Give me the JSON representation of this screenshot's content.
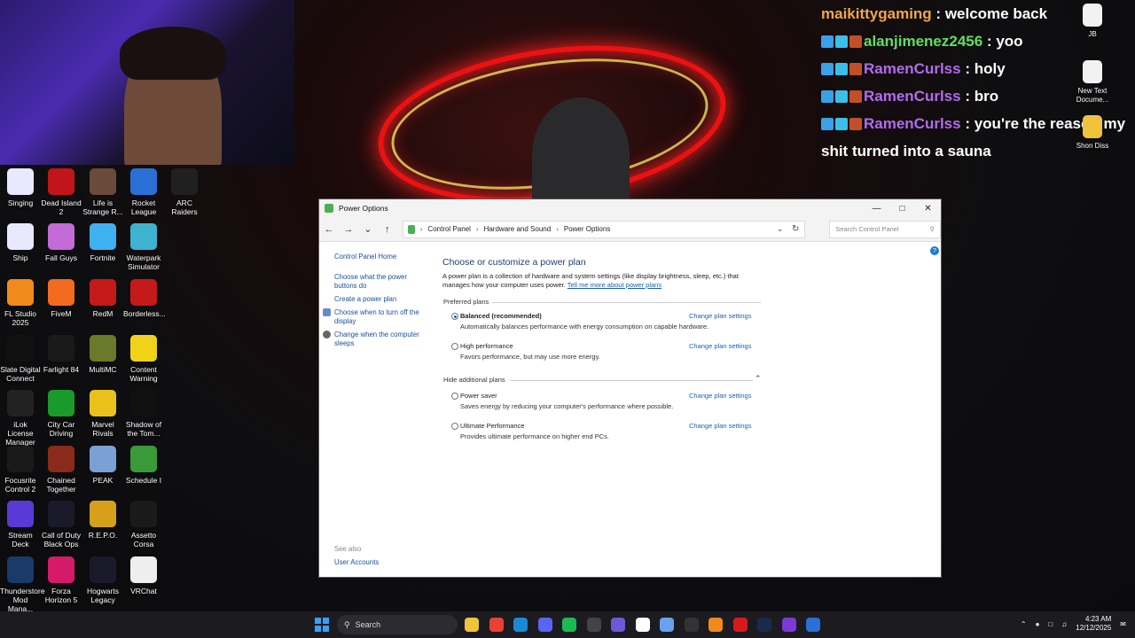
{
  "chat": [
    {
      "user": "maikittygaming",
      "color": "#f0a64b",
      "msg": "welcome back",
      "badges": false
    },
    {
      "user": "alanjimenez2456",
      "color": "#5fe05f",
      "msg": "yoo",
      "badges": true
    },
    {
      "user": "RamenCurlss",
      "color": "#b36bf0",
      "msg": "holy",
      "badges": true
    },
    {
      "user": "RamenCurlss",
      "color": "#b36bf0",
      "msg": "bro",
      "badges": true
    },
    {
      "user": "RamenCurlss",
      "color": "#b36bf0",
      "msg": "you're the reason my",
      "badges": true
    },
    {
      "user": "",
      "color": "#fff",
      "msg": "shit turned into a sauna",
      "badges": false
    }
  ],
  "desktop_icons": [
    {
      "label": "Singing",
      "icon": "h-doc-icon",
      "bg": "#e8e8ff"
    },
    {
      "label": "Dead Island 2",
      "icon": "di2-icon",
      "bg": "#c0151b"
    },
    {
      "label": "Life is Strange R...",
      "icon": "lis-icon",
      "bg": "#6a4a3a"
    },
    {
      "label": "Rocket League",
      "icon": "rl-icon",
      "bg": "#2a6fd6"
    },
    {
      "label": "ARC Raiders",
      "icon": "arc-icon",
      "bg": "#202020"
    },
    {
      "label": "Ship",
      "icon": "h-doc-icon",
      "bg": "#e8e8ff"
    },
    {
      "label": "Fall Guys",
      "icon": "fallguys-icon",
      "bg": "#c36bd6"
    },
    {
      "label": "Fortnite",
      "icon": "fortnite-icon",
      "bg": "#3fb0f0"
    },
    {
      "label": "Waterpark Simulator",
      "icon": "waterpark-icon",
      "bg": "#3db3d0"
    },
    {
      "label": "FL Studio 2025",
      "icon": "fl-icon",
      "bg": "#f08a1a"
    },
    {
      "label": "FiveM",
      "icon": "fivem-icon",
      "bg": "#f26b1f"
    },
    {
      "label": "RedM",
      "icon": "redm-icon",
      "bg": "#c41a1a"
    },
    {
      "label": "Borderless...",
      "icon": "borderless-icon",
      "bg": "#c41a1a"
    },
    {
      "label": "Slate Digital Connect",
      "icon": "slate-icon",
      "bg": "#111111"
    },
    {
      "label": "Farlight 84",
      "icon": "farlight-icon",
      "bg": "#1a1a1a"
    },
    {
      "label": "MultiMC",
      "icon": "multimc-icon",
      "bg": "#6a7a2a"
    },
    {
      "label": "Content Warning",
      "icon": "cw-icon",
      "bg": "#f0d21a"
    },
    {
      "label": "iLok License Manager",
      "icon": "ilok-icon",
      "bg": "#222222"
    },
    {
      "label": "City Car Driving",
      "icon": "ccd-icon",
      "bg": "#1a9a2a"
    },
    {
      "label": "Marvel Rivals",
      "icon": "marvel-icon",
      "bg": "#e8c21a"
    },
    {
      "label": "Shadow of the Tom...",
      "icon": "tomb-icon",
      "bg": "#111111"
    },
    {
      "label": "Focusrite Control 2",
      "icon": "focusrite-icon",
      "bg": "#1a1a1a"
    },
    {
      "label": "Chained Together",
      "icon": "chained-icon",
      "bg": "#8a2a1a"
    },
    {
      "label": "PEAK",
      "icon": "peak-icon",
      "bg": "#7aa0d6"
    },
    {
      "label": "Schedule I",
      "icon": "schedule-icon",
      "bg": "#3a9a3a"
    },
    {
      "label": "Stream Deck",
      "icon": "streamdeck-icon",
      "bg": "#5a3ad6"
    },
    {
      "label": "Call of Duty Black Ops",
      "icon": "cod-icon",
      "bg": "#1a1a2a"
    },
    {
      "label": "R.E.P.O.",
      "icon": "repo-icon",
      "bg": "#d6a01a"
    },
    {
      "label": "Assetto Corsa",
      "icon": "assetto-icon",
      "bg": "#1a1a1a"
    },
    {
      "label": "Thunderstore Mod Mana...",
      "icon": "thunderstore-icon",
      "bg": "#1a3a6a"
    },
    {
      "label": "Forza Horizon 5",
      "icon": "forza-icon",
      "bg": "#d61a6a"
    },
    {
      "label": "Hogwarts Legacy",
      "icon": "hogwarts-icon",
      "bg": "#1a1a2a"
    },
    {
      "label": "VRChat",
      "icon": "vrchat-icon",
      "bg": "#eeeeee"
    }
  ],
  "right_icons": [
    {
      "label": "JB",
      "icon": "media-icon"
    },
    {
      "label": "New Text Docume...",
      "icon": "text-doc-icon"
    },
    {
      "label": "Shon Diss",
      "icon": "folder-icon"
    }
  ],
  "window": {
    "title": "Power Options",
    "breadcrumb": [
      "Control Panel",
      "Hardware and Sound",
      "Power Options"
    ],
    "search_placeholder": "Search Control Panel",
    "left_links": {
      "home": "Control Panel Home",
      "wake": "Choose what the power buttons do",
      "create": "Create a power plan",
      "display": "Choose when to turn off the display",
      "sleep": "Change when the computer sleeps",
      "see_also": "See also",
      "accounts": "User Accounts"
    },
    "heading": "Choose or customize a power plan",
    "intro": "A power plan is a collection of hardware and system settings (like display brightness, sleep, etc.) that manages how your computer uses power.",
    "intro_link": "Tell me more about power plans",
    "preferred_label": "Preferred plans",
    "hide_label": "Hide additional plans",
    "change_label": "Change plan settings",
    "plans": [
      {
        "name": "Balanced (recommended)",
        "desc": "Automatically balances performance with energy consumption on capable hardware.",
        "selected": true
      },
      {
        "name": "High performance",
        "desc": "Favors performance, but may use more energy.",
        "selected": false
      },
      {
        "name": "Power saver",
        "desc": "Saves energy by reducing your computer's performance where possible.",
        "selected": false
      },
      {
        "name": "Ultimate Performance",
        "desc": "Provides ultimate performance on higher end PCs.",
        "selected": false
      }
    ]
  },
  "taskbar": {
    "search": "Search",
    "time": "4:23 AM",
    "date": "12/12/2025"
  }
}
